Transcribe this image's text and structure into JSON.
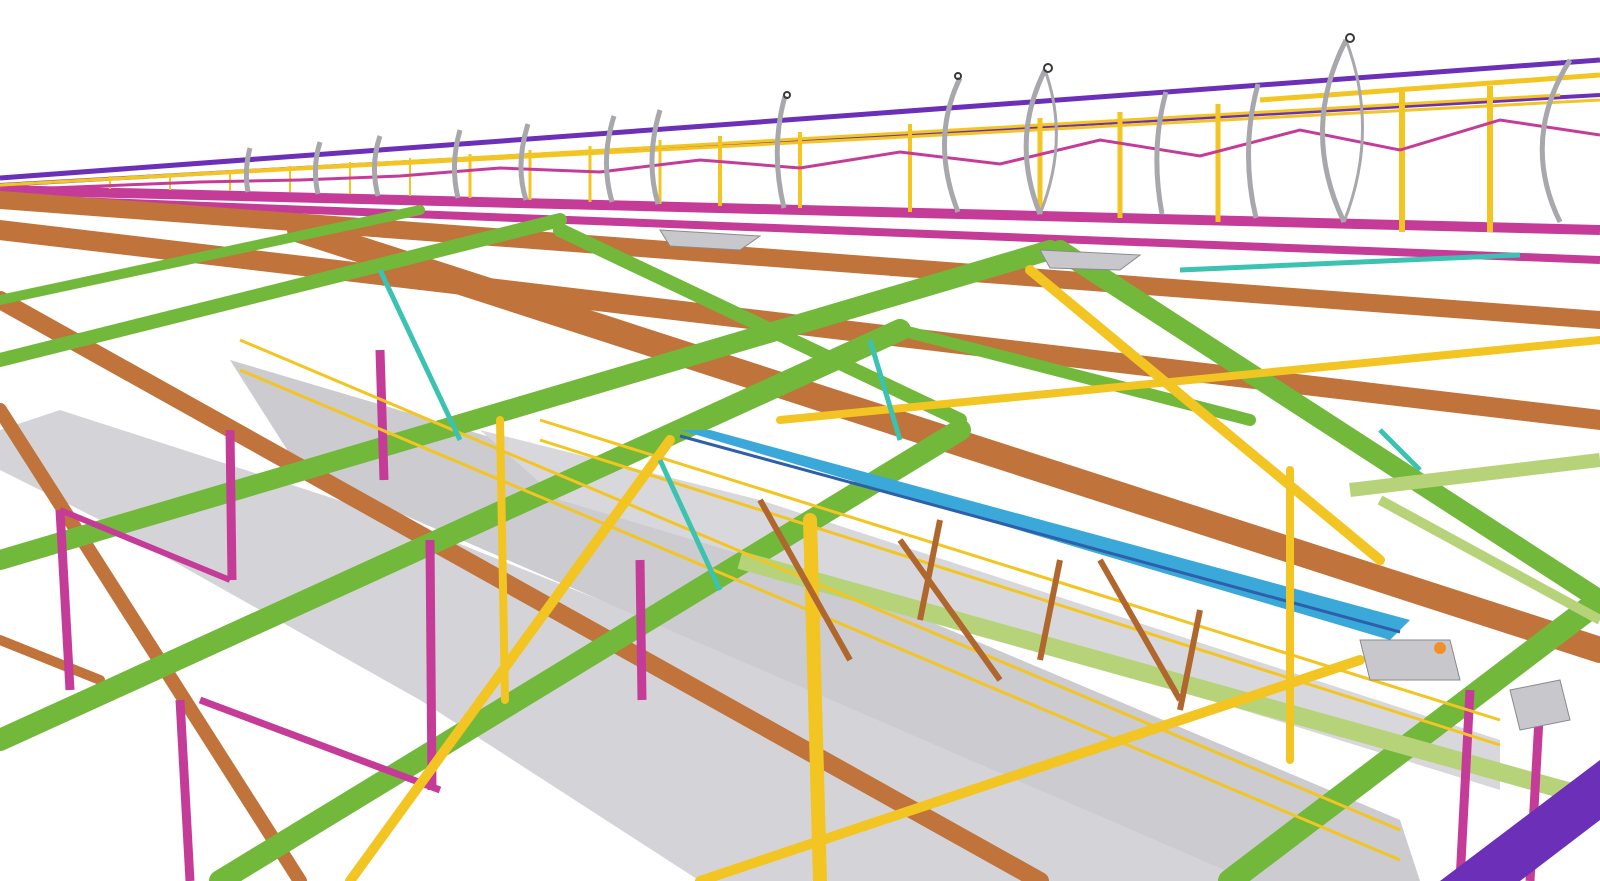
{
  "scene": {
    "subject": "steel-truss-structure-3d-model",
    "background": "#ffffff",
    "member_colors": {
      "chord_orange": "#c0733a",
      "diagonal_green": "#72b83a",
      "light_green": "#b7d37a",
      "yellow": "#f2c522",
      "magenta": "#c53c98",
      "purple": "#6b2fb8",
      "cyan": "#3aa8d8",
      "teal": "#3cc2b0",
      "blue_dark": "#2e5faa",
      "panel_gray": "#d4d4d8",
      "rail_gray": "#a8a8ac",
      "hanger_dark": "#3a3a3a"
    },
    "has_text": false
  }
}
